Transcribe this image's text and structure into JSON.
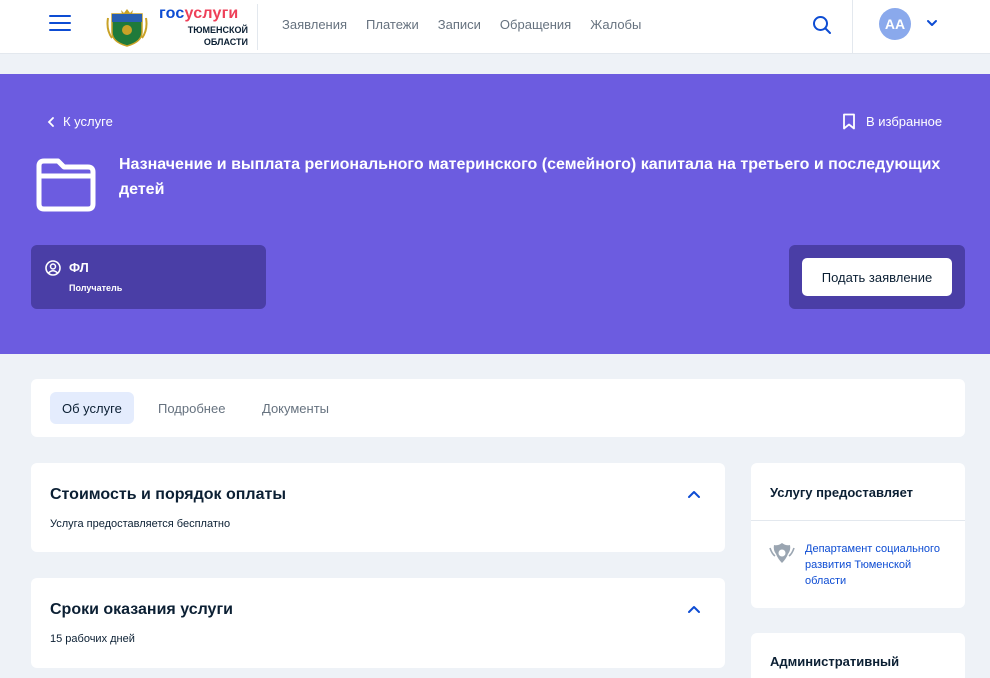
{
  "header": {
    "logo": {
      "brand_part1": "гос",
      "brand_part2": "услуги",
      "region_line1": "ТЮМЕНСКОЙ",
      "region_line2": "ОБЛАСТИ"
    },
    "nav": [
      "Заявления",
      "Платежи",
      "Записи",
      "Обращения",
      "Жалобы"
    ],
    "user_initials": "АА",
    "icons": {
      "menu": "hamburger-icon",
      "search": "search-icon",
      "user_menu": "chevron-down-icon"
    }
  },
  "hero": {
    "back_label": "К услуге",
    "favorite_label": "В избранное",
    "title": "Назначение и выплата регионального материнского (семейного) капитала на третьего и последующих детей",
    "recipient": {
      "value": "ФЛ",
      "label": "Получатель"
    },
    "apply_label": "Подать заявление"
  },
  "tabs": [
    {
      "label": "Об услуге",
      "active": true
    },
    {
      "label": "Подробнее",
      "active": false
    },
    {
      "label": "Документы",
      "active": false
    }
  ],
  "sections": [
    {
      "title": "Стоимость и порядок оплаты",
      "text": "Услуга предоставляется бесплатно"
    },
    {
      "title": "Сроки оказания услуги",
      "text": "15 рабочих дней"
    }
  ],
  "sidebar": {
    "provider_heading": "Услугу предоставляет",
    "provider_name": "Департамент социального развития Тюменской области",
    "admin_heading": "Административный"
  },
  "colors": {
    "hero_bg": "#6c5ce0",
    "hero_panel": "#4a3ea6",
    "link": "#0d4cd3",
    "accent_red": "#ee3f58",
    "tab_active": "#e4ecfd"
  }
}
